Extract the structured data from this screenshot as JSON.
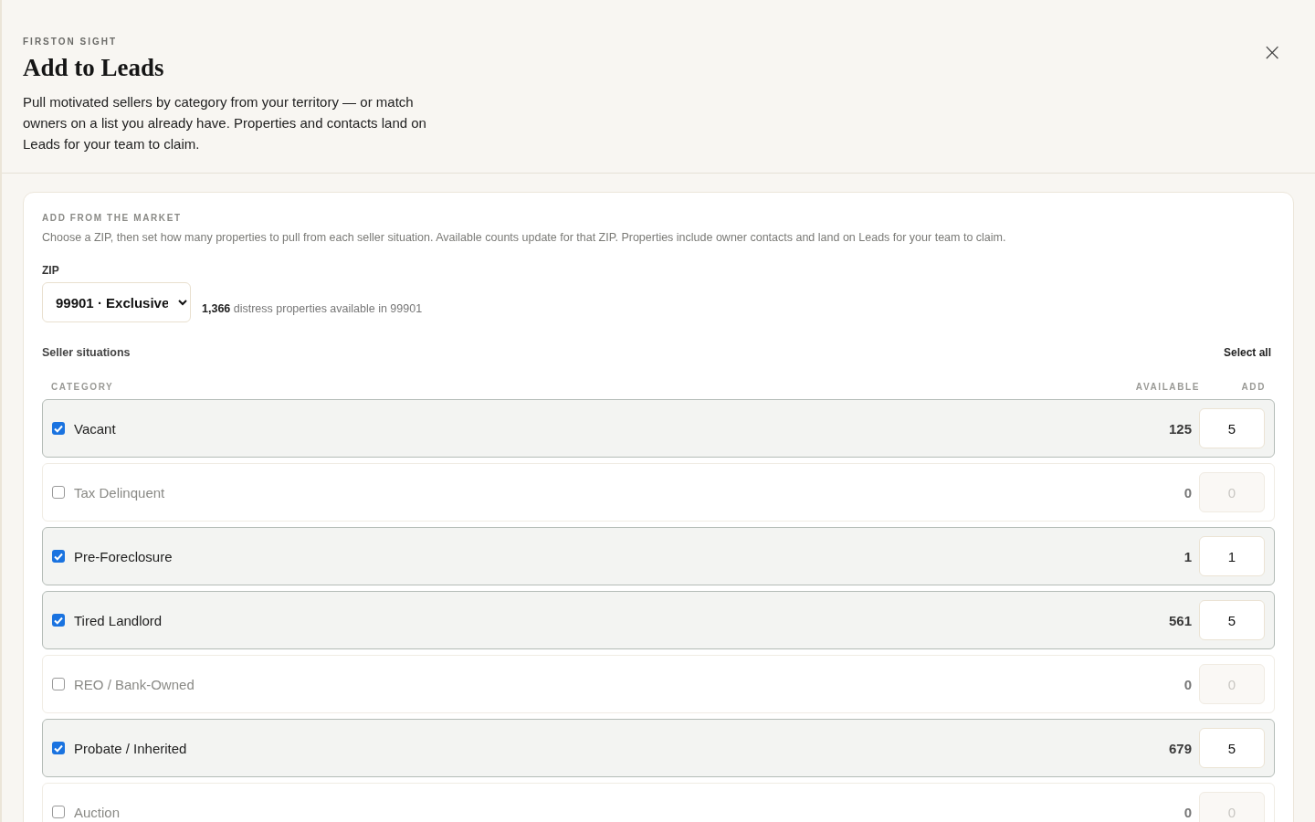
{
  "header": {
    "eyebrow": "FIRSTON SIGHT",
    "title": "Add to Leads",
    "description": "Pull motivated sellers by category from your territory — or match owners on a list you already have. Properties and contacts land on Leads for your team to claim.",
    "close": "×"
  },
  "market": {
    "heading": "ADD FROM THE MARKET",
    "description": "Choose a ZIP, then set how many properties to pull from each seller situation. Available counts update for that ZIP. Properties include owner contacts and land on Leads for your team to claim.",
    "zip_label": "ZIP",
    "zip_value": "99901 · Exclusive",
    "summary": "**1,366** distress properties available in 99901",
    "situations_label": "Seller situations",
    "select_all": "Select all",
    "columns": [
      "CATEGORY",
      "AVAILABLE",
      "ADD"
    ],
    "rows": [
      {
        "label": "Vacant",
        "checked": true,
        "available": "125",
        "add": "5"
      },
      {
        "label": "Tax Delinquent",
        "checked": false,
        "available": "0",
        "add": "0"
      },
      {
        "label": "Pre-Foreclosure",
        "checked": true,
        "available": "1",
        "add": "1"
      },
      {
        "label": "Tired Landlord",
        "checked": true,
        "available": "561",
        "add": "5"
      },
      {
        "label": "REO / Bank-Owned",
        "checked": false,
        "available": "0",
        "add": "0"
      },
      {
        "label": "Probate / Inherited",
        "checked": true,
        "available": "679",
        "add": "5"
      },
      {
        "label": "Auction",
        "checked": false,
        "available": "0",
        "add": "0"
      }
    ]
  }
}
